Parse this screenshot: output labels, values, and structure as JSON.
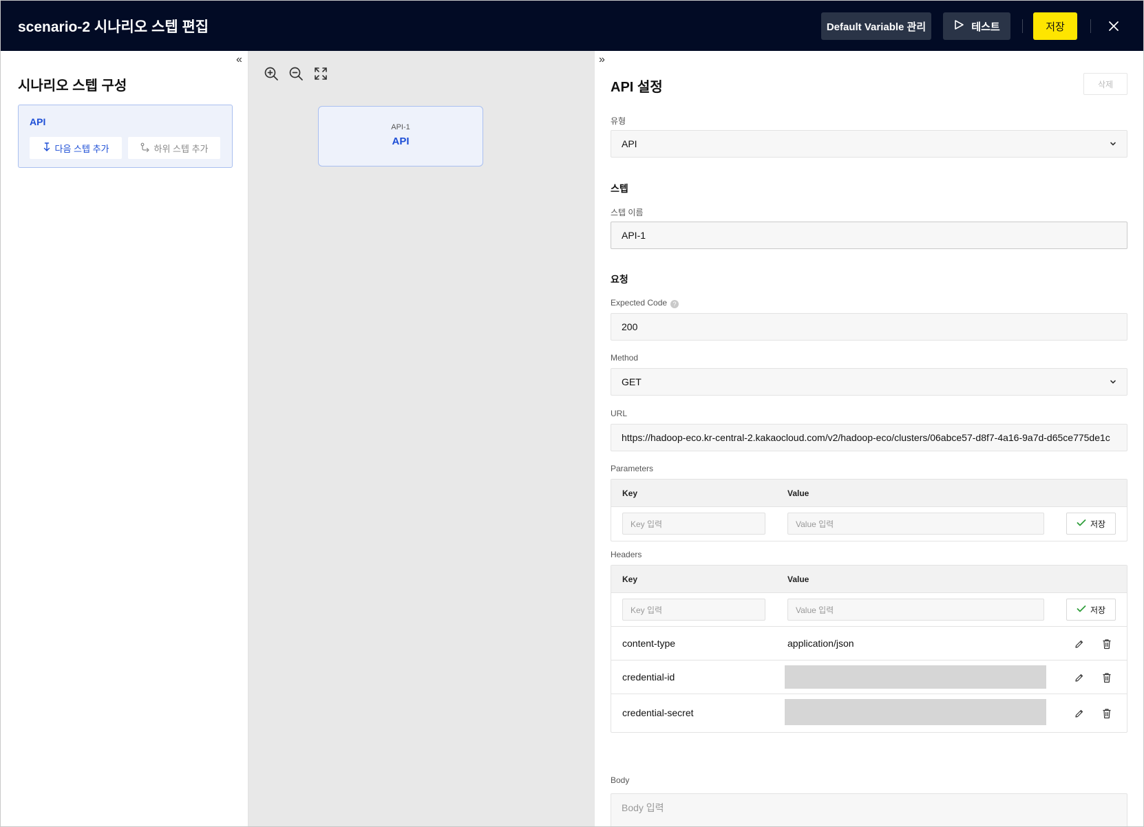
{
  "header": {
    "title": "scenario-2 시나리오 스텝 편집",
    "default_variable_label": "Default Variable 관리",
    "test_label": "테스트",
    "save_label": "저장"
  },
  "left_panel": {
    "collapse_glyph": "«",
    "title": "시나리오 스텝 구성",
    "step_card": {
      "name": "API",
      "next_step_label": "다음 스텝 추가",
      "child_step_label": "하위 스텝 추가"
    }
  },
  "canvas": {
    "node": {
      "sub_label": "API-1",
      "type_label": "API"
    }
  },
  "right_panel": {
    "expand_glyph": "»",
    "title": "API 설정",
    "delete_label": "삭제",
    "type": {
      "label": "유형",
      "value": "API"
    },
    "step_section": "스텝",
    "step_name": {
      "label": "스텝 이름",
      "value": "API-1"
    },
    "request_section": "요청",
    "expected_code": {
      "label": "Expected Code",
      "help": "?",
      "value": "200"
    },
    "method": {
      "label": "Method",
      "value": "GET"
    },
    "url": {
      "label": "URL",
      "value": "https://hadoop-eco.kr-central-2.kakaocloud.com/v2/hadoop-eco/clusters/06abce57-d8f7-4a16-9a7d-d65ce775de1c"
    },
    "parameters": {
      "label": "Parameters",
      "key_header": "Key",
      "value_header": "Value",
      "key_placeholder": "Key 입력",
      "value_placeholder": "Value 입력",
      "save_label": "저장"
    },
    "headers": {
      "label": "Headers",
      "key_header": "Key",
      "value_header": "Value",
      "key_placeholder": "Key 입력",
      "value_placeholder": "Value 입력",
      "save_label": "저장",
      "rows": [
        {
          "key": "content-type",
          "value": "application/json"
        },
        {
          "key": "credential-id",
          "value": ""
        },
        {
          "key": "credential-secret",
          "value": ""
        }
      ]
    },
    "body": {
      "label": "Body",
      "placeholder": "Body 입력"
    }
  },
  "colors": {
    "header_bg": "#020b25",
    "accent_yellow": "#fee500",
    "accent_blue": "#1e4fd6",
    "canvas_bg": "#e8e8e8"
  },
  "icons": [
    "play-icon",
    "close-icon",
    "zoom-in-icon",
    "zoom-out-icon",
    "fit-screen-icon",
    "arrow-down-icon",
    "branch-icon",
    "chevron-down-icon",
    "check-icon",
    "pencil-icon",
    "trash-icon",
    "help-icon"
  ]
}
